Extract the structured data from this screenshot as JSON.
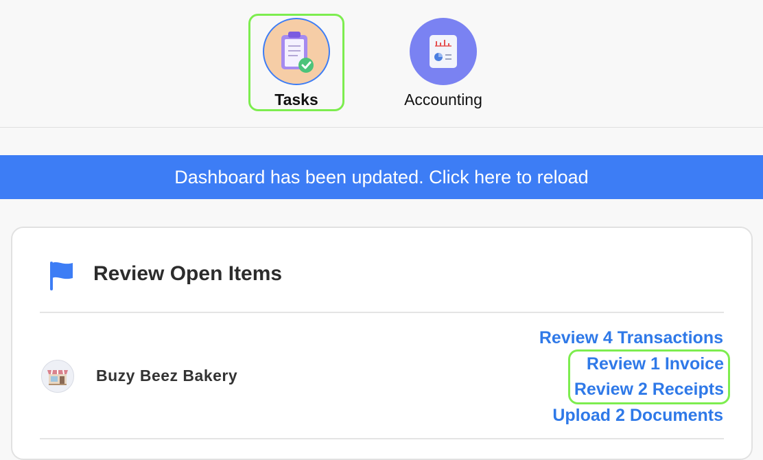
{
  "nav": {
    "tasks": {
      "label": "Tasks",
      "icon": "clipboard-check-icon"
    },
    "accounting": {
      "label": "Accounting",
      "icon": "report-chart-icon"
    }
  },
  "banner": {
    "text": "Dashboard has been updated. Click here to reload"
  },
  "card": {
    "title": "Review Open Items",
    "icon": "flag-icon",
    "rows": [
      {
        "company": "Buzy Beez Bakery",
        "avatar": "bakery-storefront-icon",
        "actions": [
          "Review 4 Transactions",
          "Review 1 Invoice",
          "Review 2 Receipts",
          "Upload 2 Documents"
        ]
      }
    ]
  },
  "colors": {
    "accent": "#3d7df5",
    "link": "#2f79e8",
    "highlight": "#7ded4f",
    "tasks_bg": "#f6cda6",
    "accounting_bg": "#7a82f2"
  }
}
